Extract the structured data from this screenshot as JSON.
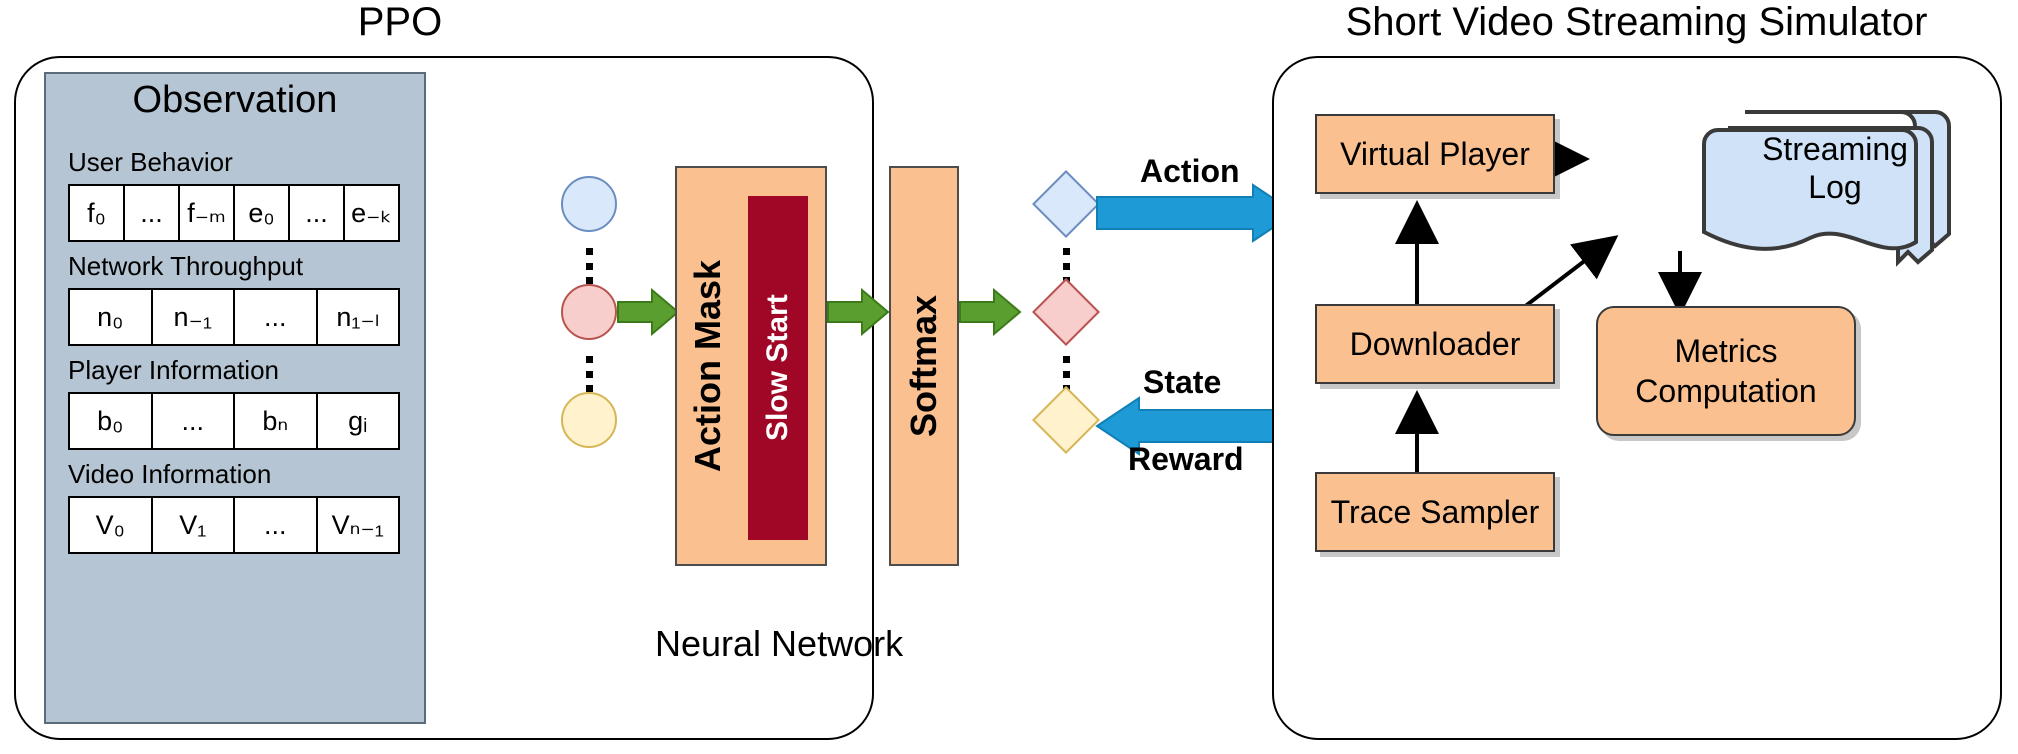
{
  "diagram": {
    "title_left": "PPO",
    "title_right": "Short Video Streaming Simulator"
  },
  "ppo": {
    "observation": {
      "title": "Observation",
      "groups": [
        {
          "label": "User Behavior",
          "cells": [
            "f₀",
            "...",
            "f₋ₘ",
            "e₀",
            "...",
            "e₋ₖ"
          ]
        },
        {
          "label": "Network Throughput",
          "cells": [
            "n₀",
            "n₋₁",
            "...",
            "n₁₋ₗ"
          ]
        },
        {
          "label": "Player Information",
          "cells": [
            "b₀",
            "...",
            "bₙ",
            "gᵢ"
          ]
        },
        {
          "label": "Video Information",
          "cells": [
            "V₀",
            "V₁",
            "...",
            "Vₙ₋₁"
          ]
        }
      ]
    },
    "neural_network": {
      "label": "Neural Network",
      "input_nodes": [
        "input-node-blue",
        "input-node-red",
        "input-node-yellow"
      ],
      "output_nodes": [
        "output-node-blue",
        "output-node-red",
        "output-node-yellow"
      ],
      "blocks": [
        {
          "name": "action-mask",
          "label": "Action Mask"
        },
        {
          "name": "slow-start",
          "label": "Slow Start"
        },
        {
          "name": "softmax",
          "label": "Softmax"
        }
      ]
    }
  },
  "interface": {
    "action_label": "Action",
    "state_label": "State",
    "reward_label": "Reward"
  },
  "simulator": {
    "blocks": [
      {
        "name": "virtual-player",
        "label": "Virtual Player"
      },
      {
        "name": "streaming-log",
        "label": "Streaming\nLog",
        "line1": "Streaming",
        "line2": "Log"
      },
      {
        "name": "downloader",
        "label": "Downloader"
      },
      {
        "name": "metrics-computation",
        "line1": "Metrics",
        "line2": "Computation"
      },
      {
        "name": "trace-sampler",
        "label": "Trace Sampler"
      }
    ]
  },
  "colors": {
    "observation_bg": "#b6c5d3",
    "orange_block": "#fac090",
    "slow_start": "#a00726",
    "green_arrow": "#5a9e2f",
    "blue_arrow": "#1e9ad6",
    "log_blue": "#cfe2f7",
    "node_blue": "#dae8fc",
    "node_red": "#f8cecc",
    "node_yellow": "#fff2cc"
  }
}
